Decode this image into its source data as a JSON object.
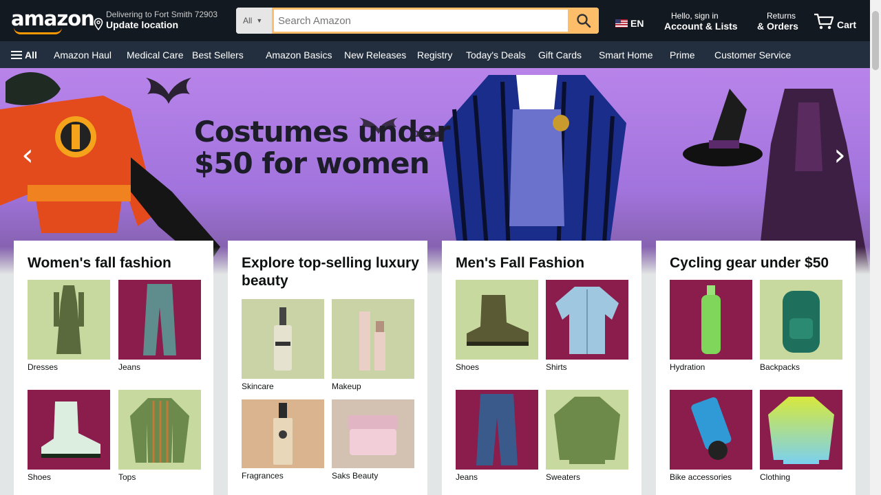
{
  "header": {
    "logo_text": "amazon",
    "deliver_line1": "Delivering to Fort Smith 72903",
    "deliver_line2": "Update location",
    "search_category": "All",
    "search_placeholder": "Search Amazon",
    "language": "EN",
    "account_line1": "Hello, sign in",
    "account_line2": "Account & Lists",
    "orders_line1": "Returns",
    "orders_line2": "& Orders",
    "cart_label": "Cart",
    "brand_color": "#131921",
    "accent_color": "#febd69"
  },
  "subnav": {
    "all_label": "All",
    "items": [
      "Amazon Haul",
      "Medical Care",
      "Best Sellers",
      "Amazon Basics",
      "New Releases",
      "Registry",
      "Today's Deals",
      "Gift Cards",
      "Smart Home",
      "Prime",
      "Customer Service"
    ]
  },
  "hero": {
    "headline_line1": "Costumes under",
    "headline_line2": "$50 for women",
    "prev_icon": "chevron-left-icon",
    "next_icon": "chevron-right-icon"
  },
  "cards": [
    {
      "title": "Women's fall fashion",
      "tiles": [
        {
          "caption": "Dresses",
          "icon": "dress-icon"
        },
        {
          "caption": "Jeans",
          "icon": "jeans-icon"
        },
        {
          "caption": "Shoes",
          "icon": "boot-icon"
        },
        {
          "caption": "Tops",
          "icon": "top-icon"
        }
      ]
    },
    {
      "title": "Explore top-selling luxury beauty",
      "tiles": [
        {
          "caption": "Skincare",
          "icon": "serum-bottle-icon"
        },
        {
          "caption": "Makeup",
          "icon": "lipstick-icon"
        },
        {
          "caption": "Fragrances",
          "icon": "perfume-icon"
        },
        {
          "caption": "Saks Beauty",
          "icon": "cream-jar-icon"
        }
      ]
    },
    {
      "title": "Men's Fall Fashion",
      "tiles": [
        {
          "caption": "Shoes",
          "icon": "boot-icon"
        },
        {
          "caption": "Shirts",
          "icon": "shirt-icon"
        },
        {
          "caption": "Jeans",
          "icon": "jeans-icon"
        },
        {
          "caption": "Sweaters",
          "icon": "sweater-icon"
        }
      ]
    },
    {
      "title": "Cycling gear under $50",
      "tiles": [
        {
          "caption": "Hydration",
          "icon": "water-bottle-icon"
        },
        {
          "caption": "Backpacks",
          "icon": "backpack-icon"
        },
        {
          "caption": "Bike accessories",
          "icon": "phone-mount-icon"
        },
        {
          "caption": "Clothing",
          "icon": "cycling-jersey-icon"
        }
      ]
    }
  ]
}
